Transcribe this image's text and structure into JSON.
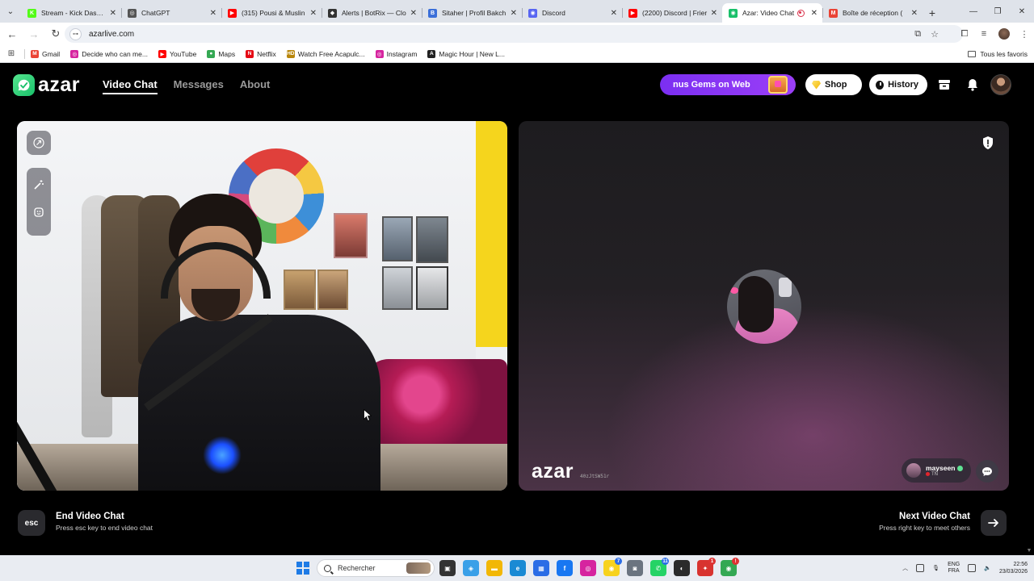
{
  "browser": {
    "tabs": [
      {
        "title": "Stream - Kick Dashbo",
        "favicon": "kick-icon",
        "color": "#53fc18",
        "glyph": "K"
      },
      {
        "title": "ChatGPT",
        "favicon": "chatgpt-icon",
        "color": "#555555",
        "glyph": "◎"
      },
      {
        "title": "(315) Pousi & Muslin",
        "favicon": "youtube-icon",
        "color": "#ff0000",
        "glyph": "▶"
      },
      {
        "title": "Alerts | BotRix — Clo",
        "favicon": "botrix-icon",
        "color": "#333333",
        "glyph": "◆"
      },
      {
        "title": "Sitaher | Profil Bakch",
        "favicon": "b-icon",
        "color": "#3b6fd9",
        "glyph": "B"
      },
      {
        "title": "Discord",
        "favicon": "discord-icon",
        "color": "#5865f2",
        "glyph": "◉"
      },
      {
        "title": "(2200) Discord | Frier",
        "favicon": "youtube-icon",
        "color": "#ff0000",
        "glyph": "▶"
      },
      {
        "title": "Azar: Video Chat",
        "favicon": "azar-icon",
        "color": "#19c06a",
        "glyph": "◉",
        "active": true
      },
      {
        "title": "Boîte de réception (",
        "favicon": "gmail-icon",
        "color": "#ea4335",
        "glyph": "M"
      }
    ],
    "url": "azarlive.com",
    "bookmarks": [
      {
        "label": "Gmail",
        "icon": "gmail-icon",
        "color": "#ea4335",
        "glyph": "M"
      },
      {
        "label": "Decide who can me...",
        "icon": "instagram-icon",
        "color": "#d6249f",
        "glyph": "◎"
      },
      {
        "label": "YouTube",
        "icon": "youtube-icon",
        "color": "#ff0000",
        "glyph": "▶"
      },
      {
        "label": "Maps",
        "icon": "maps-icon",
        "color": "#34a853",
        "glyph": "●"
      },
      {
        "label": "Netflix",
        "icon": "netflix-icon",
        "color": "#e50914",
        "glyph": "N"
      },
      {
        "label": "Watch Free Acapulc...",
        "icon": "hd-icon",
        "color": "#b8860b",
        "glyph": "HD"
      },
      {
        "label": "Instagram",
        "icon": "instagram-icon",
        "color": "#d6249f",
        "glyph": "◎"
      },
      {
        "label": "Magic Hour | New L...",
        "icon": "magic-hour-icon",
        "color": "#222222",
        "glyph": "A"
      }
    ],
    "bookmarks_folder": "Tous les favoris"
  },
  "azar": {
    "logo": "azar",
    "nav": [
      {
        "label": "Video Chat",
        "active": true
      },
      {
        "label": "Messages",
        "active": false
      },
      {
        "label": "About",
        "active": false
      }
    ],
    "gems_promo": "nus Gems on Web",
    "shop_label": "Shop",
    "history_label": "History",
    "accent_green": "#19c06a",
    "promo_purple": "#8a36f5"
  },
  "partner": {
    "watermark": "azar",
    "watermark_id": "40zJtSW51r",
    "username": "mayseen",
    "country": "TN"
  },
  "controls": {
    "end_key": "esc",
    "end_title": "End Video Chat",
    "end_hint": "Press esc key to end video chat",
    "next_title": "Next Video Chat",
    "next_hint": "Press right key to meet others"
  },
  "taskbar": {
    "search_placeholder": "Rechercher",
    "lang_top": "ENG",
    "lang_bottom": "FRA",
    "time": "22:56",
    "date": "23/03/2026",
    "apps": [
      {
        "icon": "task-view-icon",
        "color": "#333333",
        "glyph": "▣"
      },
      {
        "icon": "copilot-icon",
        "color": "#3aa0e8",
        "glyph": "◈"
      },
      {
        "icon": "file-explorer-icon",
        "color": "#f2b705",
        "glyph": "▬"
      },
      {
        "icon": "edge-icon",
        "color": "#1a8ad4",
        "glyph": "e"
      },
      {
        "icon": "store-icon",
        "color": "#2b6de6",
        "glyph": "▦"
      },
      {
        "icon": "facebook-icon",
        "color": "#1877f2",
        "glyph": "f"
      },
      {
        "icon": "instagram-icon",
        "color": "#d6249f",
        "glyph": "◎"
      },
      {
        "icon": "snapchat-icon",
        "color": "#f7d21d",
        "glyph": "◉",
        "badge": "7"
      },
      {
        "icon": "camera-icon",
        "color": "#6b7480",
        "glyph": "◙"
      },
      {
        "icon": "whatsapp-icon",
        "color": "#25d366",
        "glyph": "✆",
        "badge": "11"
      },
      {
        "icon": "obs-icon",
        "color": "#2b2b2b",
        "glyph": "◐"
      },
      {
        "icon": "app-red-icon",
        "color": "#d8332f",
        "glyph": "✦",
        "badge": "1",
        "badge_red": true
      },
      {
        "icon": "chrome-icon",
        "color": "#34a853",
        "glyph": "◉",
        "badge": "!",
        "badge_red": true
      }
    ]
  }
}
